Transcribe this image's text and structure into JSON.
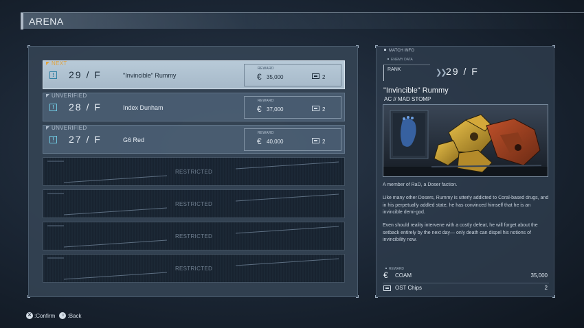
{
  "screen": {
    "title": "ARENA"
  },
  "list": [
    {
      "tag": "NEXT",
      "floor": "29 / F",
      "name": "\"Invincible\" Rummy",
      "reward_label": "REWARD",
      "reward": "35,000",
      "chips": "2",
      "selected": true
    },
    {
      "tag": "UNVERIFIED",
      "floor": "28 / F",
      "name": "Index Dunham",
      "reward_label": "REWARD",
      "reward": "37,000",
      "chips": "2",
      "selected": false
    },
    {
      "tag": "UNVERIFIED",
      "floor": "27 / F",
      "name": "G6 Red",
      "reward_label": "REWARD",
      "reward": "40,000",
      "chips": "2",
      "selected": false
    }
  ],
  "restricted": [
    "RESTRICTED",
    "RESTRICTED",
    "RESTRICTED",
    "RESTRICTED"
  ],
  "match_info": {
    "label": "MATCH INFO",
    "enemy_data_label": "ENEMY DATA",
    "rank_label": "RANK",
    "rank_floor": "29 / F",
    "enemy_name": "\"Invincible\" Rummy",
    "ac_name": "AC // MAD STOMP",
    "description": [
      "A member of RaD, a Doser faction.",
      "Like many other Dosers, Rummy is utterly addicted to Coral-based drugs, and in his perpetually addled state, he has convinced himself that he is an invincible demi-god.",
      "Even should reality intervene with a costly defeat, he will forget about the setback entirely by the next day— only death can dispel his notions of invincibility now."
    ],
    "reward_label": "REWARD",
    "rewards": [
      {
        "icon": "coam-icon",
        "name": "COAM",
        "value": "35,000"
      },
      {
        "icon": "ost-chip-icon",
        "name": "OST Chips",
        "value": "2"
      }
    ]
  },
  "footer": {
    "confirm_glyph": "✕",
    "confirm_label": ":Confirm",
    "back_glyph": "○",
    "back_label": ":Back"
  },
  "colors": {
    "accent_next": "#e2a23a",
    "selected_row": "#b8cad8",
    "info_icon": "#6fc7e0"
  }
}
